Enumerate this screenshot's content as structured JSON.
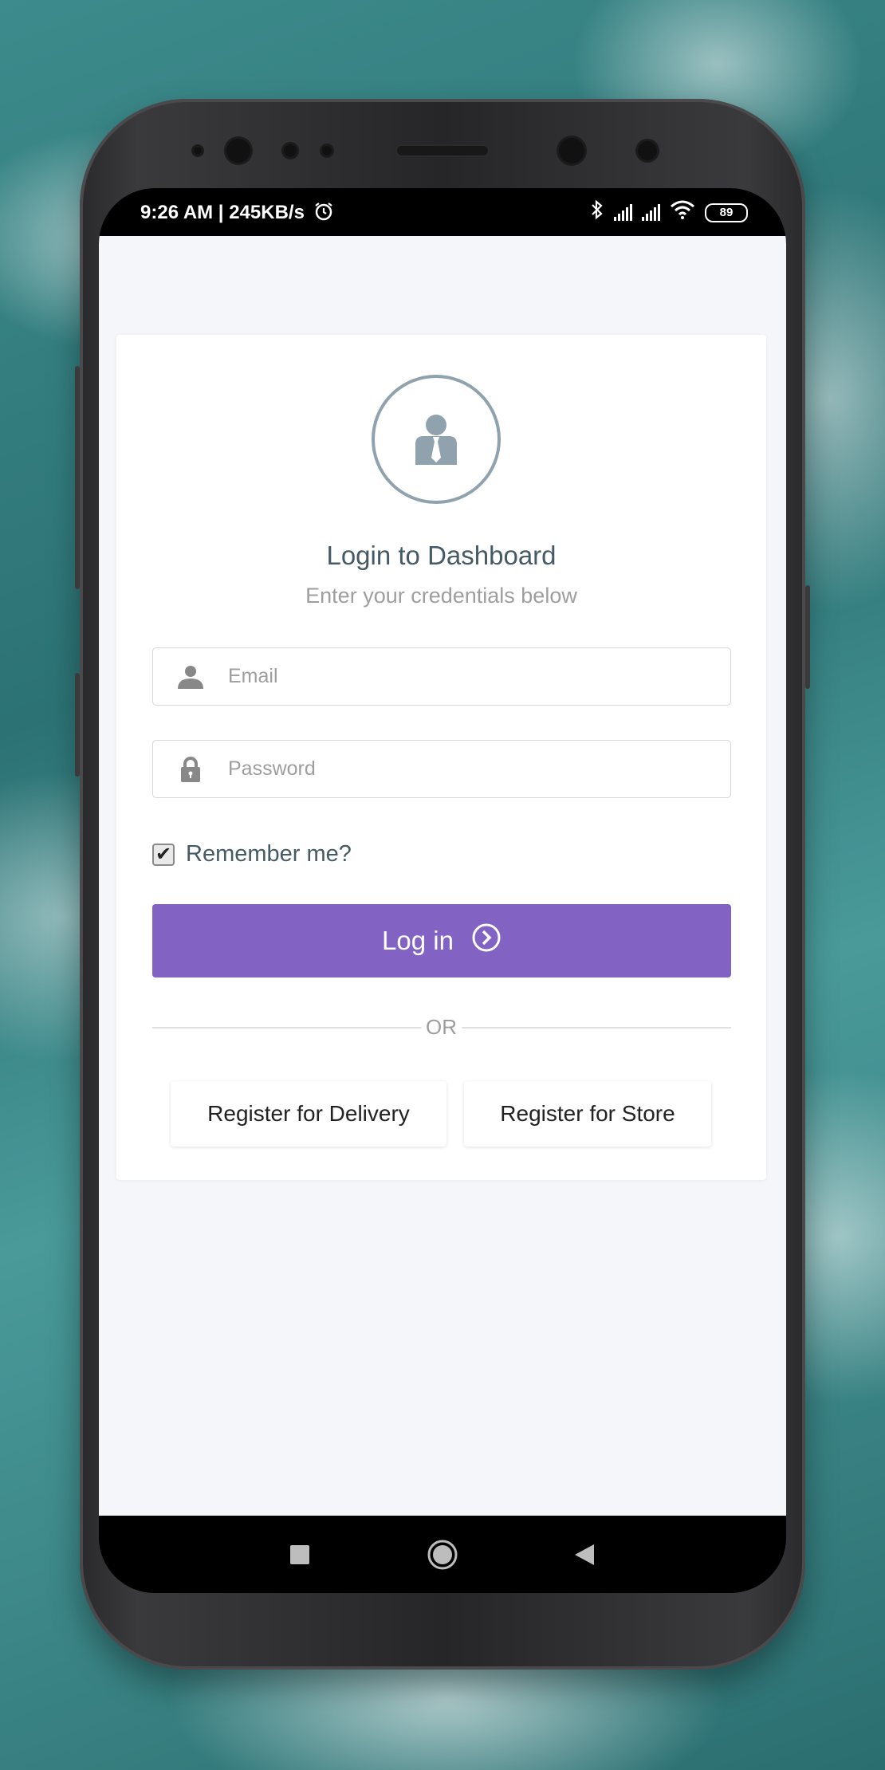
{
  "status_bar": {
    "time_text": "9:26 AM | 245KB/s",
    "battery_level": "89"
  },
  "login": {
    "title": "Login to Dashboard",
    "subtitle": "Enter your credentials below",
    "email_placeholder": "Email",
    "password_placeholder": "Password",
    "remember_label": "Remember me?",
    "remember_checked": true,
    "login_label": "Log in",
    "or_text": "OR",
    "register_delivery_label": "Register for Delivery",
    "register_store_label": "Register for Store"
  },
  "colors": {
    "primary": "#8262c3",
    "heading": "#455a64",
    "muted": "#9e9e9e",
    "screen_bg": "#f5f6fa"
  },
  "icons": {
    "avatar": "user-tie-icon",
    "email_field": "user-icon",
    "password_field": "lock-icon",
    "login_button": "arrow-circle-right-icon",
    "nav": [
      "square-recents-icon",
      "circle-home-icon",
      "triangle-back-icon"
    ]
  }
}
